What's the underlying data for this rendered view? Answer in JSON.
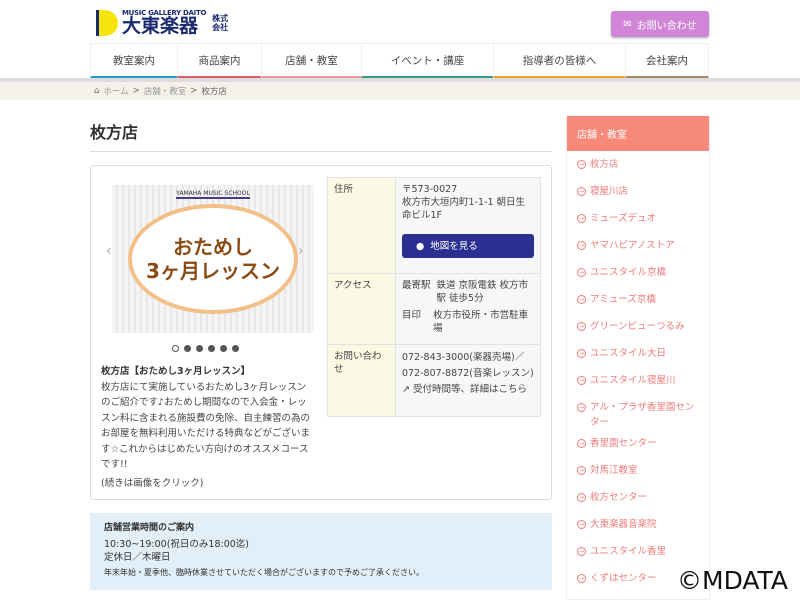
{
  "header": {
    "logo_sub": "MUSIC GALLERY DAITO",
    "logo_main": "大東楽器",
    "logo_kk": "株式会社",
    "contact_label": "お問い合わせ"
  },
  "nav": [
    {
      "label": "教室案内",
      "color": "#2a9ad0"
    },
    {
      "label": "商品案内",
      "color": "#d95e6a"
    },
    {
      "label": "店舗・教室",
      "color": "#f0959a"
    },
    {
      "label": "イベント・講座",
      "color": "#3a9a8a"
    },
    {
      "label": "指導者の皆様へ",
      "color": "#f0a030"
    },
    {
      "label": "会社案内",
      "color": "#a08a6a"
    }
  ],
  "breadcrumb": {
    "home": "ホーム",
    "sep": ">",
    "parent": "店舗・教室",
    "current": "枚方店"
  },
  "page_title": "枚方店",
  "slide": {
    "school": "YAMAHA MUSIC SCHOOL",
    "line1": "おためし",
    "line2": "3ヶ月レッスン",
    "prev": "‹",
    "next": "›"
  },
  "article": {
    "title": "枚方店【おためし3ヶ月レッスン】",
    "body": "枚方店にて実施しているおためし3ヶ月レッスンのご紹介です♪おためし期間なので入会金・レッスン料に含まれる施設費の免除、自主練習の為のお部屋を無料利用いただける特典などがございます☆これからはじめたい方向けのオススメコースです!!",
    "more": "(続きは画像をクリック)"
  },
  "info": {
    "address_label": "住所",
    "postal": "〒573-0027",
    "address": "枚方市大垣内町1-1-1 朝日生命ビル1F",
    "map_button": "地図を見る",
    "access_label": "アクセス",
    "station_key": "最寄駅",
    "station_val": "鉄道 京阪電鉄 枚方市駅 徒歩5分",
    "landmark_key": "目印",
    "landmark_val": "枚方市役所・市営駐車場",
    "contact_label": "お問い合わせ",
    "tel1": "072-843-3000(楽器売場)／",
    "tel2": "072-807-8872(音楽レッスン)",
    "details_link": "受付時間等、詳細はこちら"
  },
  "hours": {
    "title": "店舗営業時間のご案内",
    "time": "10:30~19:00(祝日のみ18:00迄)",
    "closed": "定休日／木曜日",
    "note": "年末年始・夏季他、臨時休業させていただく場合がございますので予めご了承ください。"
  },
  "sidebar": {
    "title": "店舗・教室",
    "items": [
      "枚方店",
      "寝屋川店",
      "ミューズデュオ",
      "ヤマハピアノストア",
      "ユニスタイル京橋",
      "アミューズ京橋",
      "グリーンビューつるみ",
      "ユニスタイル大日",
      "ユニスタイル寝屋川",
      "アル・プラザ香里園センター",
      "香里園センター",
      "対馬江教室",
      "枚方センター",
      "大東楽器音楽院",
      "ユニスタイル香里",
      "くずはセンター"
    ]
  },
  "watermark": "©MDATA"
}
